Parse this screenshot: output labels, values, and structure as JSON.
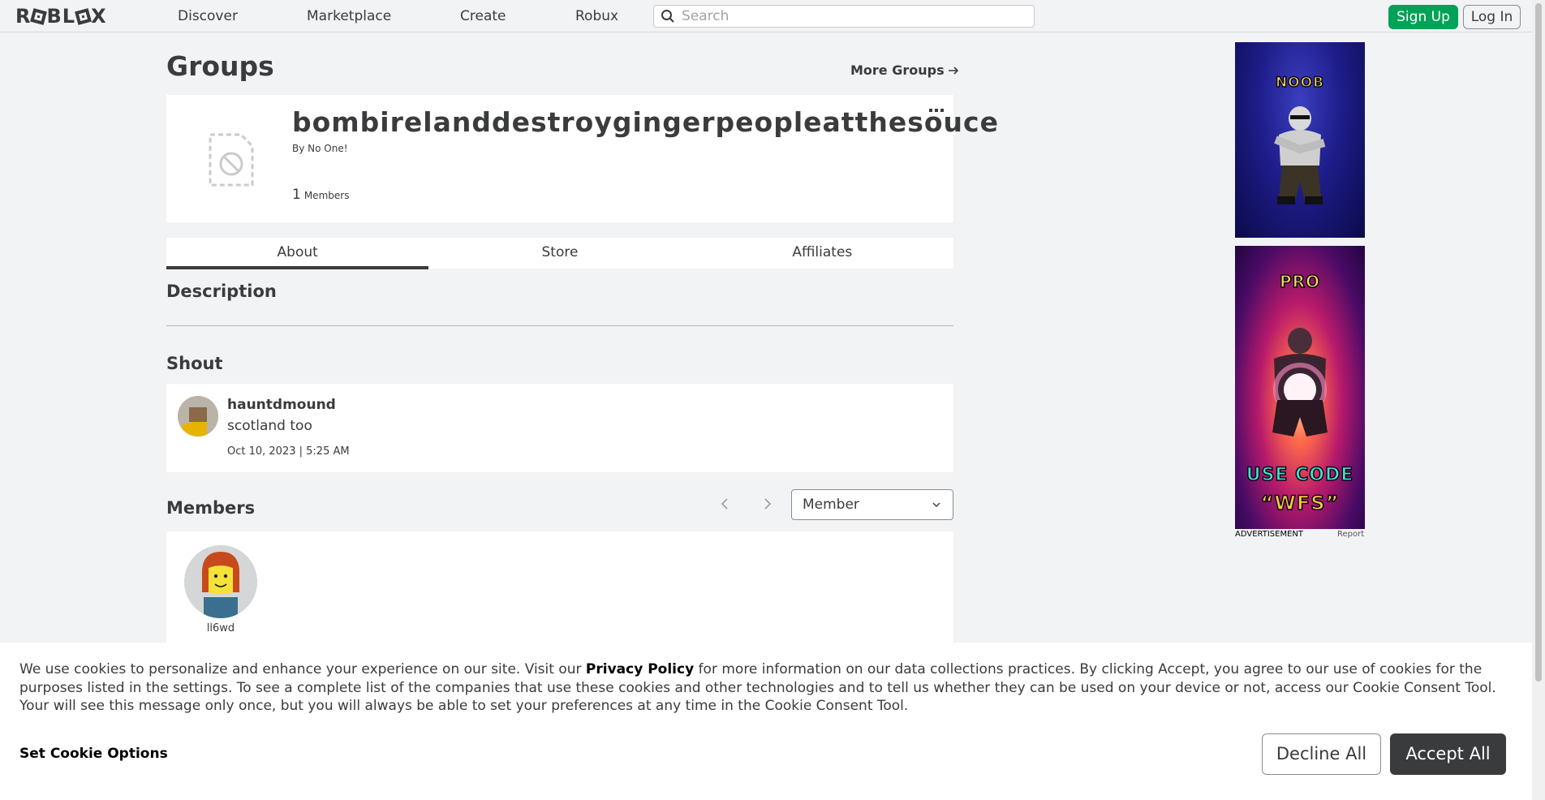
{
  "nav": {
    "logo": "ROBLOX",
    "links": [
      "Discover",
      "Marketplace",
      "Create",
      "Robux"
    ],
    "search_placeholder": "Search",
    "signup": "Sign Up",
    "login": "Log In"
  },
  "page": {
    "title": "Groups",
    "more_groups": "More Groups"
  },
  "group": {
    "name": "bombirelanddestroygingerpeopleatthesouce",
    "owner": "By No One!",
    "member_count": "1",
    "member_label": "Members"
  },
  "tabs": [
    "About",
    "Store",
    "Affiliates"
  ],
  "description": {
    "title": "Description"
  },
  "shout": {
    "title": "Shout",
    "user": "hauntdmound",
    "body": "scotland too",
    "date": "Oct 10, 2023 | 5:25 AM"
  },
  "members": {
    "title": "Members",
    "role_selected": "Member",
    "list": [
      {
        "name": "ll6wd"
      }
    ]
  },
  "ads": {
    "ad1_text": "NOOB",
    "ad2_top": "PRO",
    "ad2_line1": "USE CODE",
    "ad2_line2": "“WFS”",
    "label": "ADVERTISEMENT",
    "report": "Report"
  },
  "cookie": {
    "text_before": "We use cookies to personalize and enhance your experience on our site. Visit our ",
    "privacy_link": "Privacy Policy",
    "text_after": " for more information on our data collections practices. By clicking Accept, you agree to our use of cookies for the purposes listed in the settings. To see a complete list of the companies that use these cookies and other technologies and to tell us whether they can be used on your device or not, access our Cookie Consent Tool. Your will see this message only once, but you will always be able to set your preferences at any time in the Cookie Consent Tool.",
    "options": "Set Cookie Options",
    "decline": "Decline All",
    "accept": "Accept All"
  },
  "colors": {
    "signup": "#00a258",
    "accept": "#393b3d",
    "text": "#393b3d",
    "background": "#f2f3f5"
  }
}
